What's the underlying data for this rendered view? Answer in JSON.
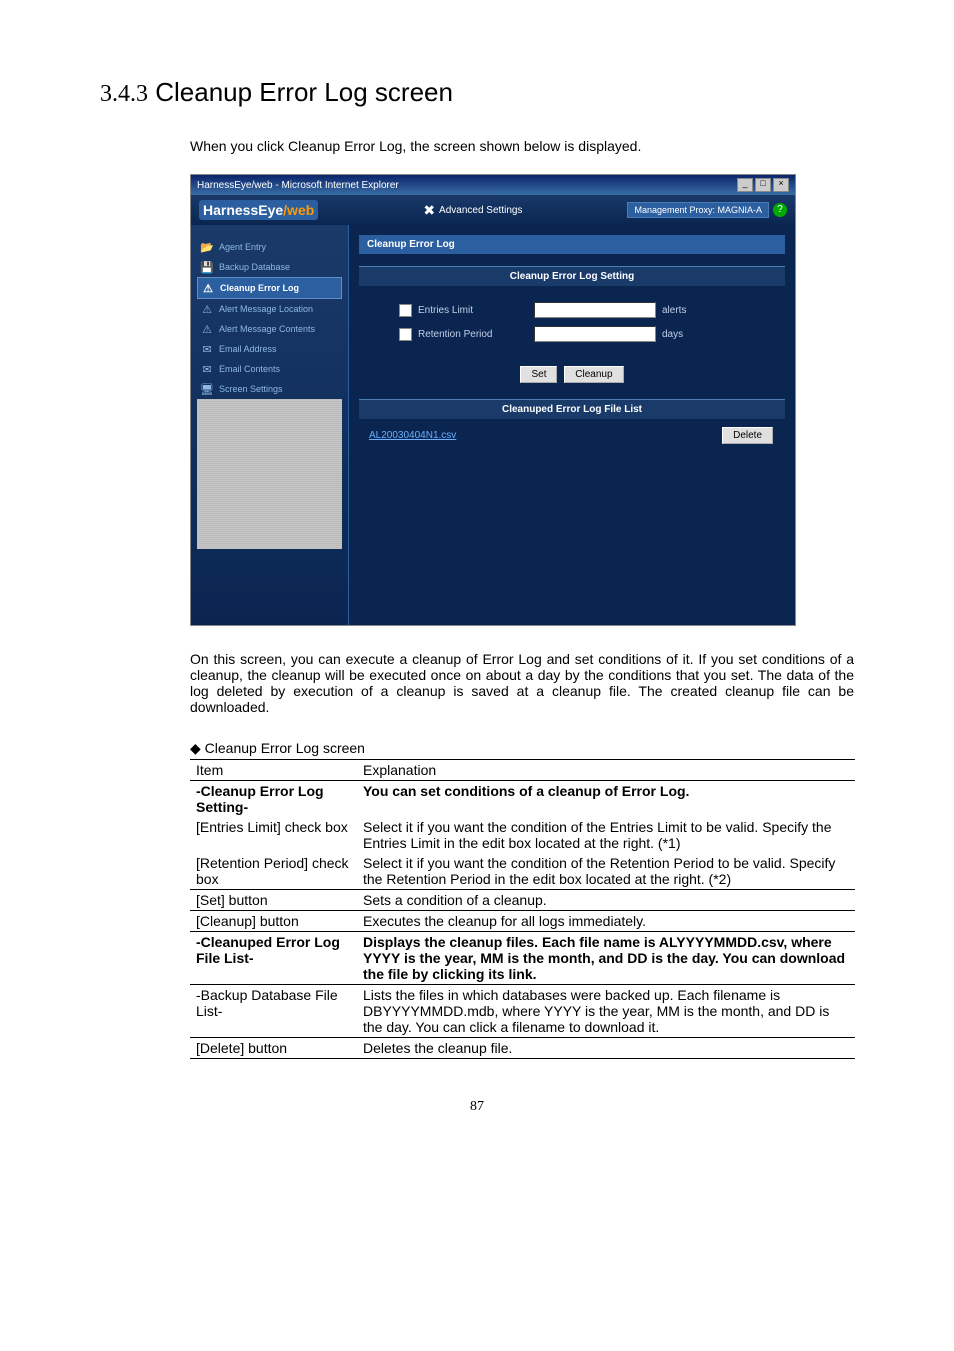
{
  "heading": {
    "num": "3.4.3",
    "title": "Cleanup Error Log screen"
  },
  "intro": "When you click Cleanup Error Log, the screen shown below is displayed.",
  "browser": {
    "title": "HarnessEye/web - Microsoft Internet Explorer",
    "brand_main": "HarnessEye",
    "brand_suffix": "/web",
    "advanced": "Advanced Settings",
    "proxy_label": "Management Proxy: MAGNIA-A",
    "help_glyph": "?"
  },
  "sidebar": {
    "items": [
      {
        "label": "Agent Entry",
        "icon": "📂"
      },
      {
        "label": "Backup Database",
        "icon": "💾"
      },
      {
        "label": "Cleanup Error Log",
        "icon": "⚠"
      },
      {
        "label": "Alert Message Location",
        "icon": "⚠"
      },
      {
        "label": "Alert Message Contents",
        "icon": "⚠"
      },
      {
        "label": "Email Address",
        "icon": "✉"
      },
      {
        "label": "Email Contents",
        "icon": "✉"
      },
      {
        "label": "Screen Settings",
        "icon": "🖥"
      }
    ]
  },
  "content": {
    "title": "Cleanup Error Log",
    "setting_hdr": "Cleanup Error Log Setting",
    "entries_limit": "Entries Limit",
    "retention_period": "Retention Period",
    "unit_alerts": "alerts",
    "unit_days": "days",
    "btn_set": "Set",
    "btn_cleanup": "Cleanup",
    "filelist_hdr": "Cleanuped Error Log File List",
    "file_link": "AL20030404N1.csv",
    "btn_delete": "Delete"
  },
  "desc": "On this screen, you can execute a cleanup of Error Log and set conditions of it. If you set conditions of a cleanup, the cleanup will be executed once on about a day by the conditions that you set. The data of the log deleted by execution of a cleanup is saved at a cleanup file. The created cleanup file can be downloaded.",
  "table_title": "◆ Cleanup Error Log screen",
  "table": {
    "hdr_item": "Item",
    "hdr_expl": "Explanation",
    "rows": [
      {
        "item": "-Cleanup Error Log Setting-",
        "expl": "You can set conditions of a cleanup of Error Log.",
        "bold": true
      },
      {
        "item": "[Entries Limit] check box",
        "expl": "Select it if you want the condition of the Entries Limit to be valid. Specify the Entries Limit in the edit box located at the right. (*1)"
      },
      {
        "item": "[Retention Period] check box",
        "expl": "Select it if you want the condition of the Retention Period to be valid. Specify the Retention Period in the edit box located at the right. (*2)",
        "border": true
      },
      {
        "item": "[Set] button",
        "expl": "Sets a condition of a cleanup.",
        "border": true
      },
      {
        "item": "[Cleanup] button",
        "expl": "Executes the cleanup for all logs immediately.",
        "border": true
      },
      {
        "item": "-Cleanuped Error Log File List-",
        "expl": "Displays the cleanup files. Each file name is ALYYYYMMDD.csv, where YYYY is the year, MM is the month, and DD is the day. You can download the file by clicking its link.",
        "bold": true,
        "border": true
      },
      {
        "item": "-Backup Database File List-",
        "expl": "Lists the files in which databases were backed up. Each filename is DBYYYYMMDD.mdb, where YYYY is the year, MM is the month, and DD is the day. You can click a filename to download it.",
        "border": true
      },
      {
        "item": "[Delete] button",
        "expl": "Deletes the cleanup file.",
        "thick": true
      }
    ]
  },
  "pagenum": "87"
}
